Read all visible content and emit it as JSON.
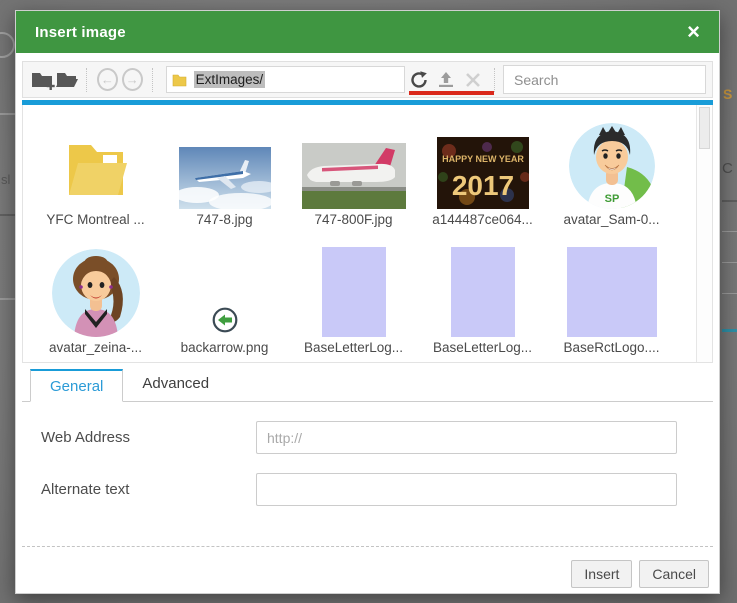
{
  "window": {
    "title": "Insert image",
    "close_glyph": "×"
  },
  "toolbar": {
    "address_value": "ExtImages/",
    "search_placeholder": "Search",
    "back_glyph": "←",
    "forward_glyph": "→"
  },
  "file_list": {
    "items": [
      {
        "name": "YFC Montreal ...",
        "kind": "folder"
      },
      {
        "name": "747-8.jpg",
        "kind": "photo-plane-sky"
      },
      {
        "name": "747-800F.jpg",
        "kind": "photo-plane-cargo"
      },
      {
        "name": "a144487ce064...",
        "kind": "photo-newyear",
        "text_top": "HAPPY NEW YEAR",
        "text_big": "2017"
      },
      {
        "name": "avatar_Sam-0...",
        "kind": "avatar-male",
        "badge": "SP"
      },
      {
        "name": "avatar_zeina-...",
        "kind": "avatar-female"
      },
      {
        "name": "backarrow.png",
        "kind": "icon-back-arrow"
      },
      {
        "name": "BaseLetterLog...",
        "kind": "placeholder-rect"
      },
      {
        "name": "BaseLetterLog...",
        "kind": "placeholder-rect"
      },
      {
        "name": "BaseRctLogo....",
        "kind": "placeholder-rect-wide"
      }
    ]
  },
  "tabs": [
    {
      "label": "General",
      "active": true
    },
    {
      "label": "Advanced",
      "active": false
    }
  ],
  "form": {
    "fields": [
      {
        "label": "Web Address",
        "placeholder": "http://",
        "value": ""
      },
      {
        "label": "Alternate text",
        "placeholder": "",
        "value": ""
      }
    ]
  },
  "footer": {
    "buttons": [
      {
        "label": "Insert"
      },
      {
        "label": "Cancel"
      }
    ]
  },
  "background": {
    "left_text": "sl",
    "right_letters": [
      "S",
      "C"
    ]
  },
  "colors": {
    "header_green": "#3F9641",
    "accent_blue": "#199CD8",
    "tab_active_blue": "#2B9BD7",
    "annotation_red": "#DA291C",
    "placeholder_lavender": "#C9C9F8",
    "folder_yellow": "#EDC849",
    "avatar_bg_blue": "#CDEAF7",
    "badge_green": "#3F9C35"
  }
}
